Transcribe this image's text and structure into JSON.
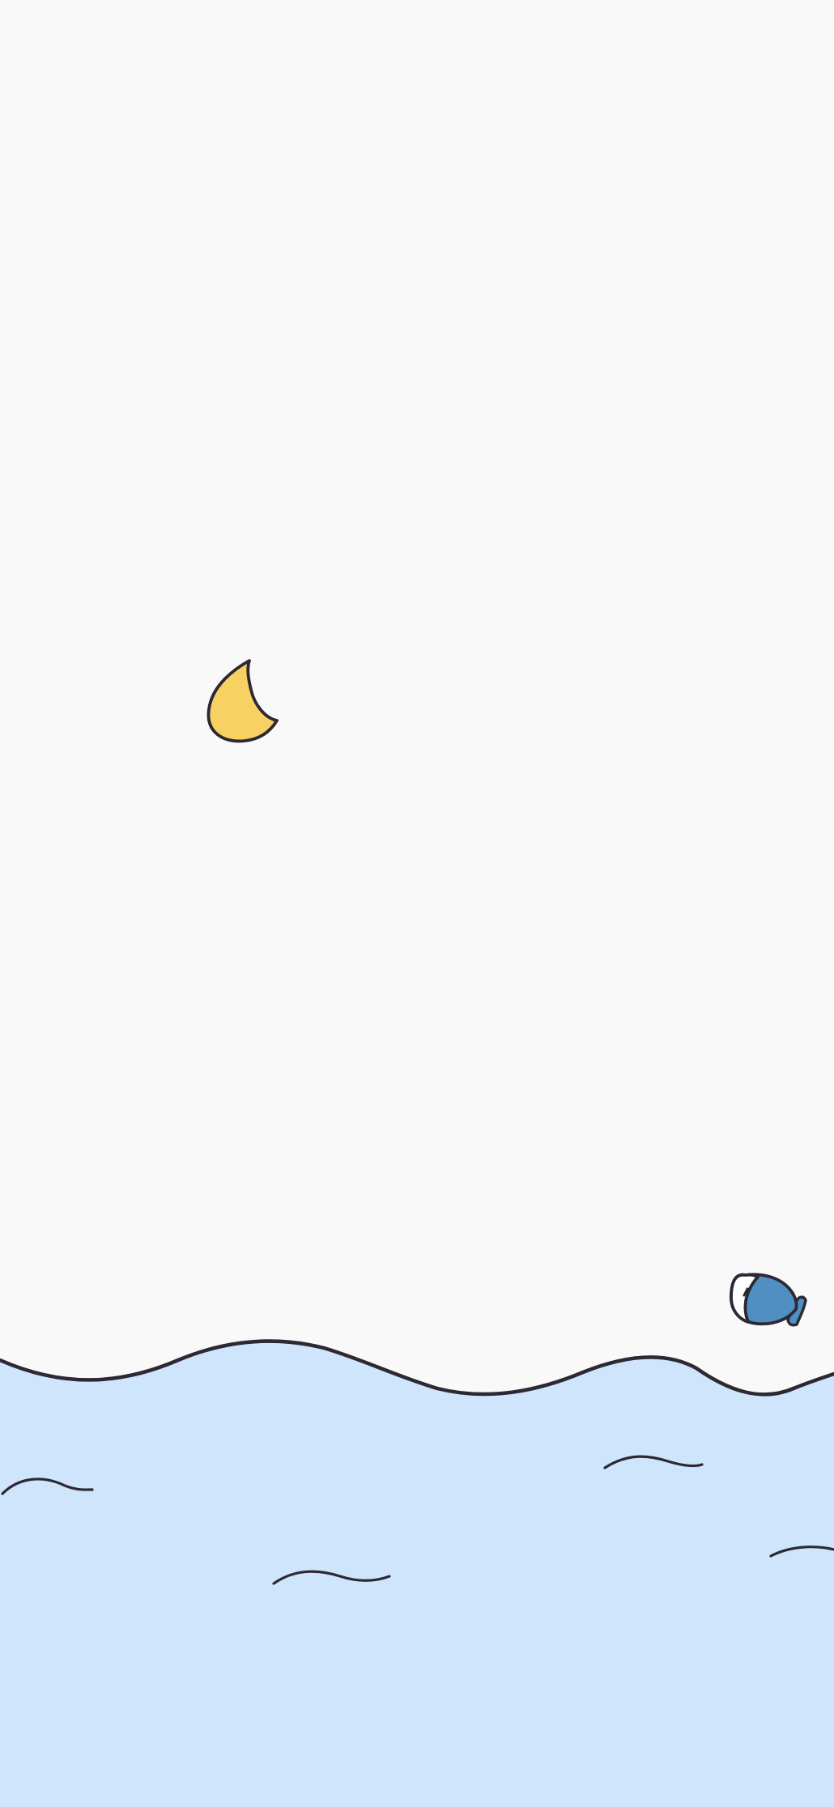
{
  "wallpaper": {
    "colors": {
      "sky": "#f9f9f9",
      "sea": "#cee5fb",
      "outline": "#2d2833",
      "moon": "#f8d163",
      "fish_body": "#4f8fc1",
      "fish_head": "#ffffff"
    },
    "elements": {
      "moon": "crescent-moon-icon",
      "fish": "fish-icon",
      "sea": "ocean-waves"
    }
  }
}
